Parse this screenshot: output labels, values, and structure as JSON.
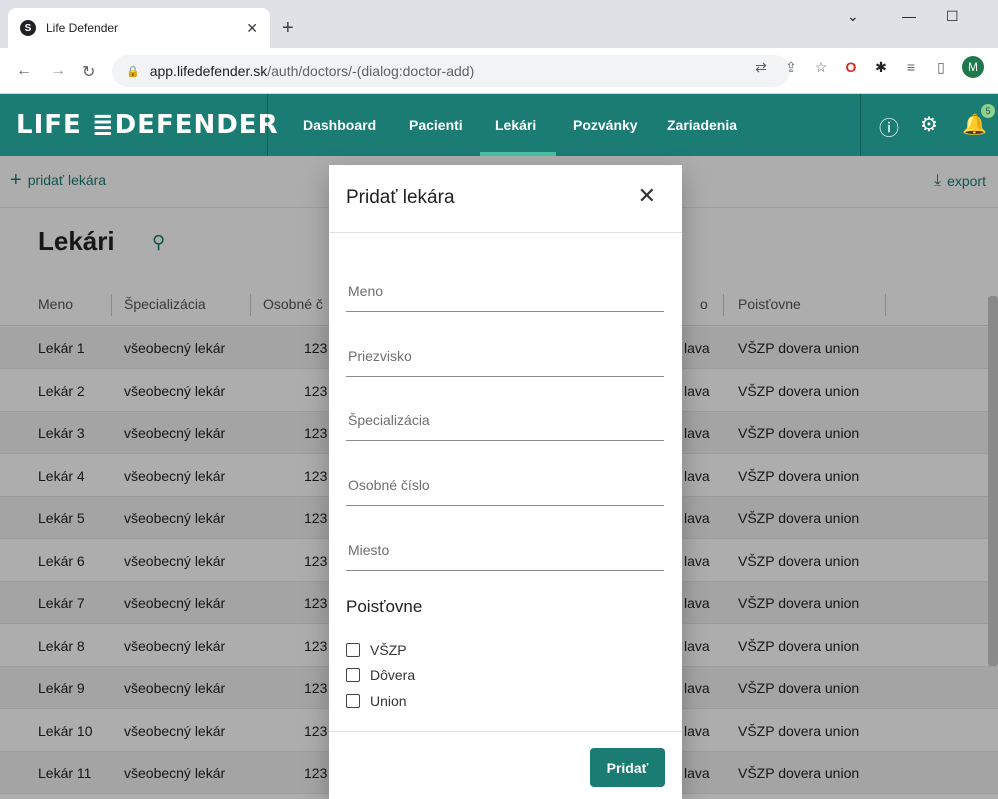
{
  "browser": {
    "tab_title": "Life Defender",
    "tab_close": "✕",
    "new_tab": "+",
    "url_domain": "app.lifedefender.sk",
    "url_path": "/auth/doctors/-(dialog:doctor-add)",
    "avatar_letter": "M",
    "window": {
      "minimize": "—",
      "maximize": "☐",
      "dropdown": "⌄"
    }
  },
  "header": {
    "logo": "LIFE ≣DEFENDER",
    "nav": [
      "Dashboard",
      "Pacienti",
      "Lekári",
      "Pozvánky",
      "Zariadenia"
    ],
    "active_nav_index": 2,
    "notification_count": "5",
    "accent": "#1a7c72"
  },
  "toolbar": {
    "add_label": "pridať lekára",
    "export_label": "export"
  },
  "page": {
    "title": "Lekári"
  },
  "table": {
    "headers": [
      "Meno",
      "Špecializácia",
      "Osobné č",
      "o",
      "Poisťovne"
    ],
    "rows": [
      [
        "Lekár 1",
        "všeobecný lekár",
        "123",
        "lava",
        "VŠZP dovera union"
      ],
      [
        "Lekár 2",
        "všeobecný lekár",
        "123",
        "lava",
        "VŠZP dovera union"
      ],
      [
        "Lekár 3",
        "všeobecný lekár",
        "123",
        "lava",
        "VŠZP dovera union"
      ],
      [
        "Lekár 4",
        "všeobecný lekár",
        "123",
        "lava",
        "VŠZP dovera union"
      ],
      [
        "Lekár 5",
        "všeobecný lekár",
        "123",
        "lava",
        "VŠZP dovera union"
      ],
      [
        "Lekár 6",
        "všeobecný lekár",
        "123",
        "lava",
        "VŠZP dovera union"
      ],
      [
        "Lekár 7",
        "všeobecný lekár",
        "123",
        "lava",
        "VŠZP dovera union"
      ],
      [
        "Lekár 8",
        "všeobecný lekár",
        "123",
        "lava",
        "VŠZP dovera union"
      ],
      [
        "Lekár 9",
        "všeobecný lekár",
        "123",
        "lava",
        "VŠZP dovera union"
      ],
      [
        "Lekár 10",
        "všeobecný lekár",
        "123",
        "lava",
        "VŠZP dovera union"
      ],
      [
        "Lekár 11",
        "všeobecný lekár",
        "123",
        "lava",
        "VŠZP dovera union"
      ]
    ]
  },
  "modal": {
    "title": "Pridať lekára",
    "fields": [
      {
        "label": "Meno",
        "value": ""
      },
      {
        "label": "Priezvisko",
        "value": ""
      },
      {
        "label": "Špecializácia",
        "value": ""
      },
      {
        "label": "Osobné číslo",
        "value": ""
      },
      {
        "label": "Miesto",
        "value": ""
      }
    ],
    "insurers_title": "Poisťovne",
    "insurers": [
      {
        "label": "VŠZP",
        "checked": false
      },
      {
        "label": "Dôvera",
        "checked": false
      },
      {
        "label": "Union",
        "checked": false
      }
    ],
    "submit_label": "Pridať"
  }
}
